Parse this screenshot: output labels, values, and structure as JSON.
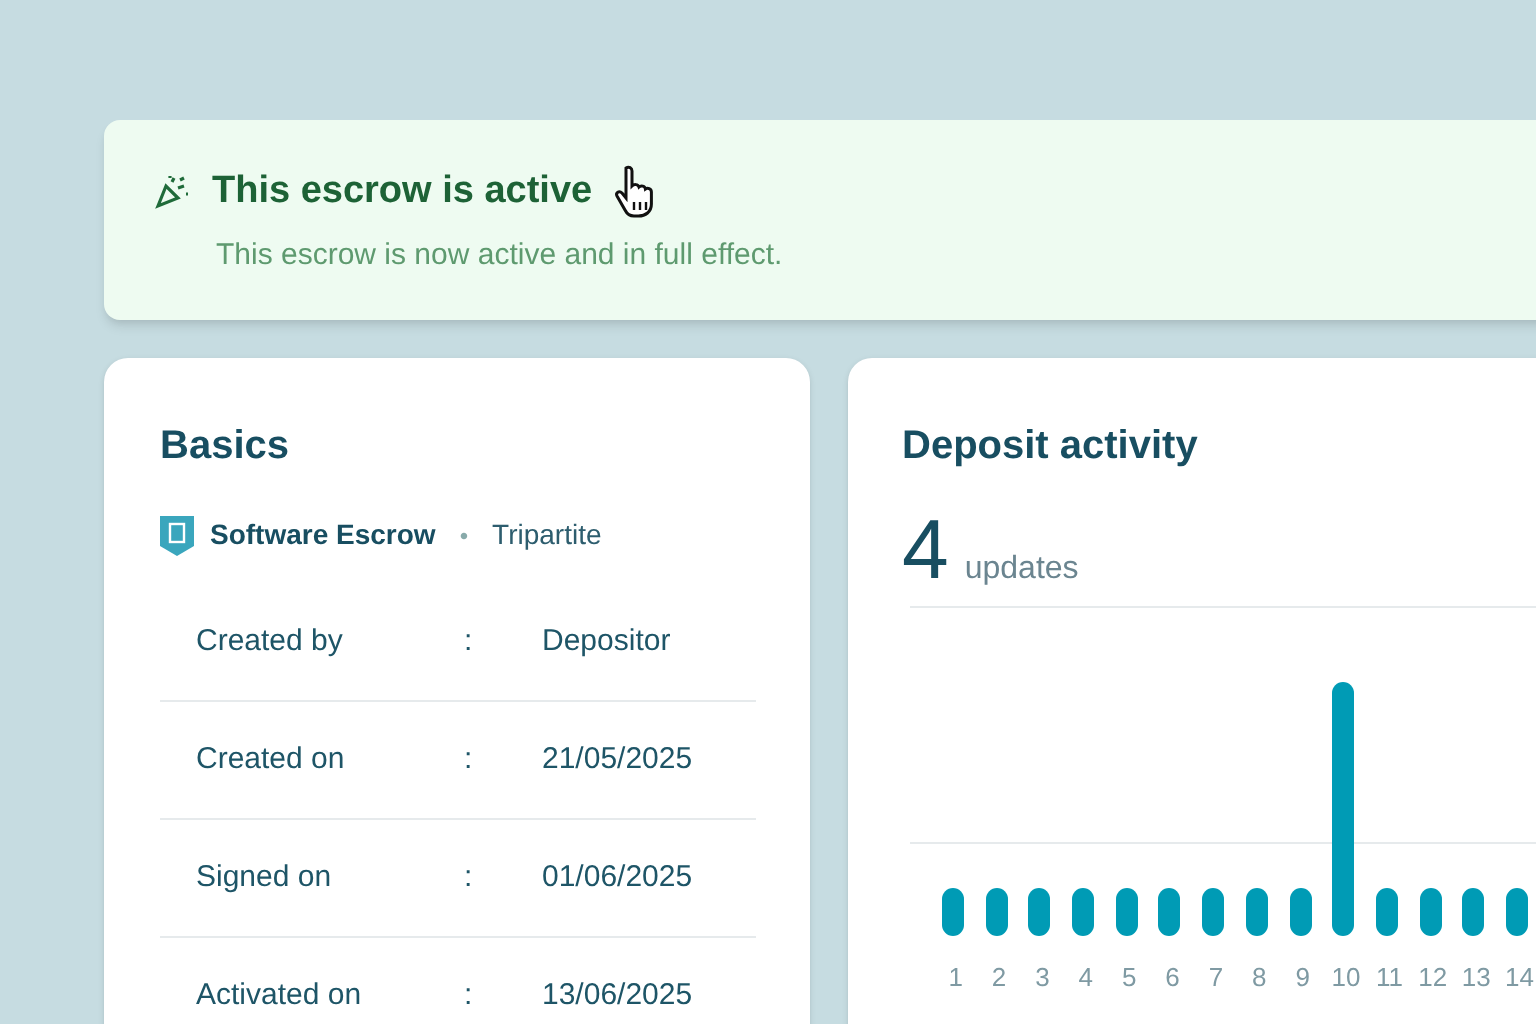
{
  "banner": {
    "title": "This escrow is active",
    "message": "This escrow is now active and in full effect."
  },
  "basics": {
    "title": "Basics",
    "product": "Software Escrow",
    "separator": "•",
    "type": "Tripartite",
    "rows": [
      {
        "label": "Created by",
        "colon": ":",
        "value": "Depositor"
      },
      {
        "label": "Created on",
        "colon": ":",
        "value": "21/05/2025"
      },
      {
        "label": "Signed on",
        "colon": ":",
        "value": "01/06/2025"
      },
      {
        "label": "Activated on",
        "colon": ":",
        "value": "13/06/2025"
      }
    ]
  },
  "deposit_activity": {
    "title": "Deposit activity",
    "count": "4",
    "count_label": "updates",
    "days": [
      {
        "label": "1",
        "peak": false
      },
      {
        "label": "2",
        "peak": false
      },
      {
        "label": "3",
        "peak": false
      },
      {
        "label": "4",
        "peak": false
      },
      {
        "label": "5",
        "peak": false
      },
      {
        "label": "6",
        "peak": false
      },
      {
        "label": "7",
        "peak": false
      },
      {
        "label": "8",
        "peak": false
      },
      {
        "label": "9",
        "peak": false
      },
      {
        "label": "10",
        "peak": true
      },
      {
        "label": "11",
        "peak": false
      },
      {
        "label": "12",
        "peak": false
      },
      {
        "label": "13",
        "peak": false
      },
      {
        "label": "14",
        "peak": false
      }
    ]
  }
}
